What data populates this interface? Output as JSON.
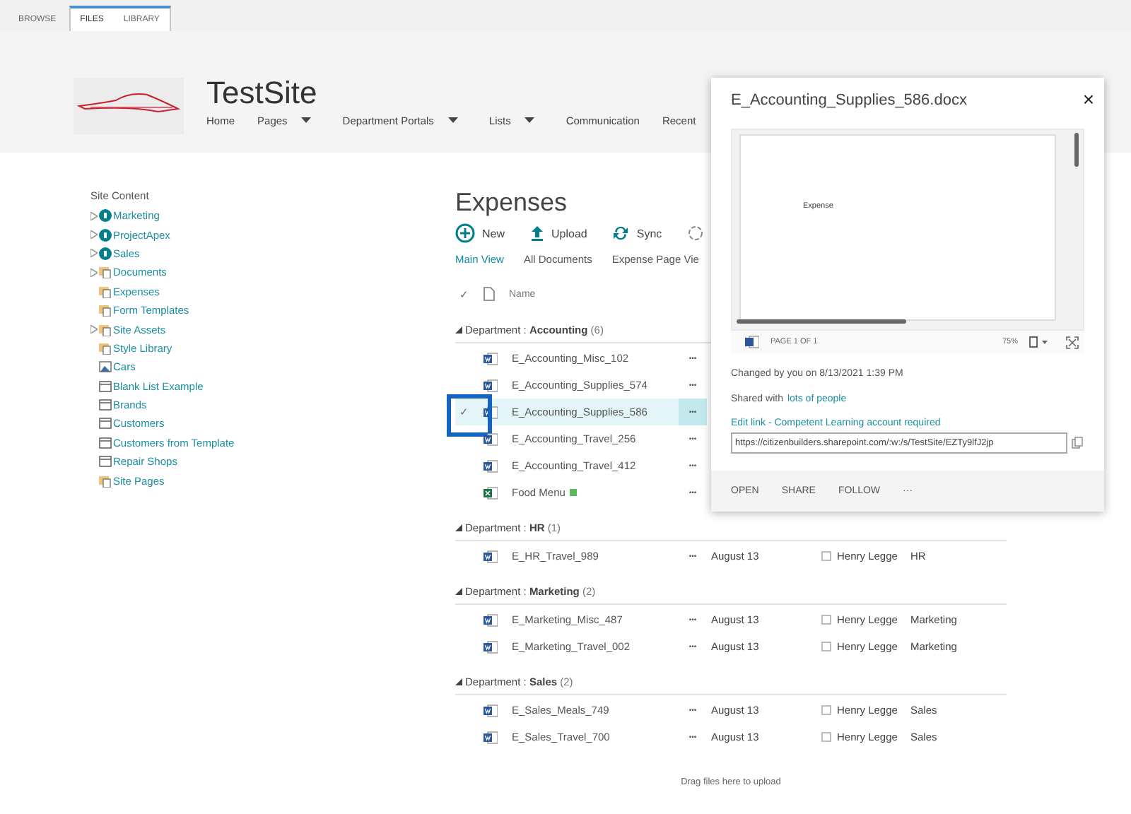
{
  "ribbon": {
    "tabs": [
      {
        "label": "BROWSE",
        "selected": false
      },
      {
        "label": "FILES",
        "selected": true
      },
      {
        "label": "LIBRARY",
        "selected": false
      }
    ]
  },
  "site": {
    "title": "TestSite",
    "nav": [
      {
        "label": "Home",
        "dropdown": false
      },
      {
        "label": "Pages",
        "dropdown": true
      },
      {
        "label": "Department Portals",
        "dropdown": true
      },
      {
        "label": "Lists",
        "dropdown": true
      },
      {
        "label": "Communication",
        "dropdown": false
      },
      {
        "label": "Recent",
        "dropdown": false
      }
    ]
  },
  "site_content": {
    "title": "Site Content",
    "items": [
      {
        "label": "Marketing",
        "kind": "subsite",
        "expandable": true
      },
      {
        "label": "ProjectApex",
        "kind": "subsite",
        "expandable": true
      },
      {
        "label": "Sales",
        "kind": "subsite",
        "expandable": true
      },
      {
        "label": "Documents",
        "kind": "library",
        "expandable": true
      },
      {
        "label": "Expenses",
        "kind": "library",
        "expandable": false
      },
      {
        "label": "Form Templates",
        "kind": "library",
        "expandable": false
      },
      {
        "label": "Site Assets",
        "kind": "library",
        "expandable": true
      },
      {
        "label": "Style Library",
        "kind": "library",
        "expandable": false
      },
      {
        "label": "Cars",
        "kind": "pictures",
        "expandable": false
      },
      {
        "label": "Blank List Example",
        "kind": "list",
        "expandable": false
      },
      {
        "label": "Brands",
        "kind": "list",
        "expandable": false
      },
      {
        "label": "Customers",
        "kind": "list",
        "expandable": false
      },
      {
        "label": "Customers from Template",
        "kind": "list",
        "expandable": false
      },
      {
        "label": "Repair Shops",
        "kind": "list",
        "expandable": false
      },
      {
        "label": "Site Pages",
        "kind": "library",
        "expandable": false
      }
    ]
  },
  "library": {
    "title": "Expenses",
    "commands": [
      {
        "label": "New",
        "kind": "new"
      },
      {
        "label": "Upload",
        "kind": "upload"
      },
      {
        "label": "Sync",
        "kind": "sync"
      },
      {
        "kind": "share"
      }
    ],
    "views": [
      {
        "label": "Main View",
        "selected": true
      },
      {
        "label": "All Documents",
        "selected": false
      },
      {
        "label": "Expense Page Vie",
        "selected": false
      }
    ],
    "select_all": "✓",
    "columns": [
      {
        "label": "Name"
      }
    ],
    "groups": [
      {
        "header": "Department : **Accounting**",
        "count": "(6)",
        "expanded": true,
        "items": [
          {
            "name": "E_Accounting_Misc_102",
            "kind": "word",
            "selected": false,
            "is_new": false,
            "more": "•••"
          },
          {
            "name": "E_Accounting_Supplies_574",
            "kind": "word",
            "selected": false,
            "is_new": false,
            "more": "•••"
          },
          {
            "name": "E_Accounting_Supplies_586",
            "kind": "word",
            "selected": true,
            "is_new": false,
            "check_mark": "✓",
            "more": "•••"
          },
          {
            "name": "E_Accounting_Travel_256",
            "kind": "word",
            "selected": false,
            "is_new": false,
            "more": "•••"
          },
          {
            "name": "E_Accounting_Travel_412",
            "kind": "word",
            "selected": false,
            "is_new": false,
            "more": "•••"
          },
          {
            "name": "Food Menu",
            "kind": "excel",
            "selected": false,
            "is_new": true,
            "more": "•••"
          }
        ]
      },
      {
        "header": "Department : **HR**",
        "count": "(1)",
        "expanded": true,
        "items": [
          {
            "name": "E_HR_Travel_989",
            "kind": "word",
            "selected": false,
            "is_new": false,
            "more": "•••",
            "modified": "August 13",
            "checked": false,
            "modified_by": "Henry Legge",
            "department": "HR"
          }
        ]
      },
      {
        "header": "Department : **Marketing**",
        "count": "(2)",
        "expanded": true,
        "items": [
          {
            "name": "E_Marketing_Misc_487",
            "kind": "word",
            "selected": false,
            "is_new": false,
            "more": "•••",
            "modified": "August 13",
            "checked": false,
            "modified_by": "Henry Legge",
            "department": "Marketing"
          },
          {
            "name": "E_Marketing_Travel_002",
            "kind": "word",
            "selected": false,
            "is_new": false,
            "more": "•••",
            "modified": "August 13",
            "checked": false,
            "modified_by": "Henry Legge",
            "department": "Marketing"
          }
        ]
      },
      {
        "header": "Department : **Sales**",
        "count": "(2)",
        "expanded": true,
        "items": [
          {
            "name": "E_Sales_Meals_749",
            "kind": "word",
            "selected": false,
            "is_new": false,
            "more": "•••",
            "modified": "August 13",
            "checked": false,
            "modified_by": "Henry Legge",
            "department": "Sales"
          },
          {
            "name": "E_Sales_Travel_700",
            "kind": "word",
            "selected": false,
            "is_new": false,
            "more": "•••",
            "modified": "August 13",
            "checked": false,
            "modified_by": "Henry Legge",
            "department": "Sales"
          }
        ]
      }
    ],
    "drop_hint": "Drag files here to upload"
  },
  "callout": {
    "title": "E_Accounting_Supplies_586.docx",
    "close": "×",
    "preview_text": "Expense",
    "page": "PAGE 1 OF 1",
    "zoom": "75%",
    "changed": "Changed by you on 8/13/2021 1:39 PM",
    "shared_prefix": "Shared with",
    "shared_link": "lots of people",
    "edit_link": "Edit link - Competent Learning account required",
    "url": "https://citizenbuilders.sharepoint.com/:w:/s/TestSite/EZTy9lfJ2jp",
    "actions": [
      "OPEN",
      "SHARE",
      "FOLLOW",
      "···"
    ]
  }
}
